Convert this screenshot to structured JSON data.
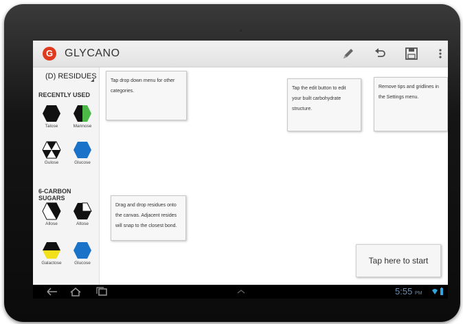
{
  "app": {
    "title": "GLYCANO",
    "logo_letter": "G"
  },
  "actionbar": {
    "edit_icon": "pencil-icon",
    "undo_icon": "undo-icon",
    "save_icon": "save-icon",
    "menu_icon": "overflow-menu-icon"
  },
  "sidebar": {
    "category_button": "(D) RESIDUES",
    "recent_heading": "RECENTLY USED",
    "recent": [
      {
        "name": "Talose",
        "icon": "talose-hexagon-icon"
      },
      {
        "name": "Mannose",
        "icon": "mannose-hexagon-icon"
      },
      {
        "name": "Gulose",
        "icon": "gulose-hexagon-icon"
      },
      {
        "name": "Glucose",
        "icon": "glucose-hexagon-icon"
      }
    ],
    "six_carbon_heading": "6-CARBON SUGARS",
    "six_carbon": [
      {
        "name": "Allose",
        "icon": "allose-hexagon-icon"
      },
      {
        "name": "Altose",
        "icon": "altose-hexagon-icon"
      },
      {
        "name": "Galactose",
        "icon": "galactose-hexagon-icon"
      },
      {
        "name": "Glucose",
        "icon": "glucose-hexagon-icon"
      }
    ]
  },
  "tips": {
    "dropdown": "Tap drop down menu for other categories.",
    "edit": "Tap the edit button to edit your built carbohydrate structure.",
    "settings": "Remove tips and gridlines in the Settings menu.",
    "drag": "Drag and drop residues onto the canvas. Adjacent resides will snap to the closest bond."
  },
  "start_button": "Tap here to start",
  "status": {
    "time": "5:55",
    "ampm": "PM"
  },
  "colors": {
    "logo_red": "#e03a1e",
    "glucose_blue": "#1a73c9",
    "mannose_green": "#4cb848",
    "galactose_yellow": "#f2e01b",
    "clock_blue": "#6f8fb0"
  }
}
